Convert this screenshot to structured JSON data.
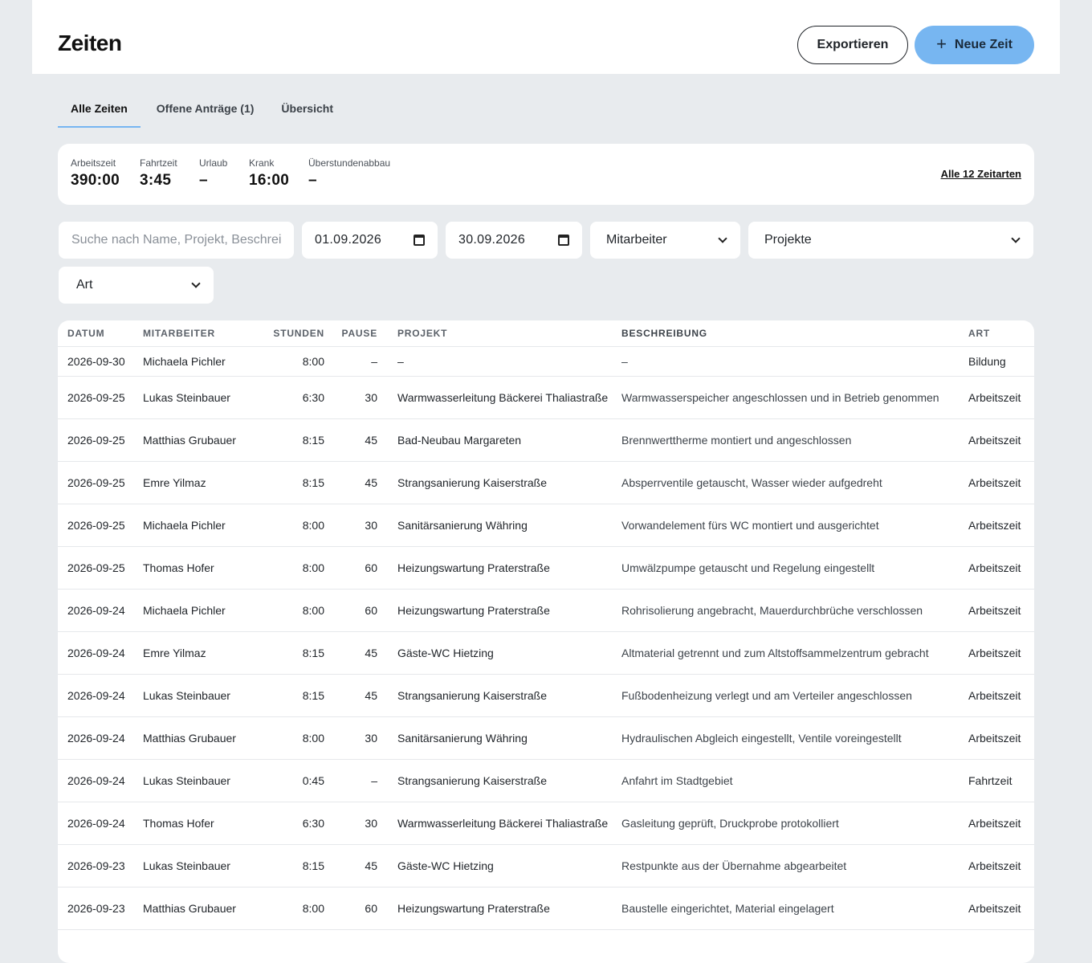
{
  "header": {
    "title": "Zeiten",
    "export_label": "Exportieren",
    "new_label": "Neue Zeit"
  },
  "tabs": [
    {
      "label": "Alle Zeiten",
      "active": true
    },
    {
      "label": "Offene Anträge (1)",
      "active": false
    },
    {
      "label": "Übersicht",
      "active": false
    }
  ],
  "summary": {
    "stats": [
      {
        "label": "Arbeitszeit",
        "value": "390:00"
      },
      {
        "label": "Fahrtzeit",
        "value": "3:45"
      },
      {
        "label": "Urlaub",
        "value": "–"
      },
      {
        "label": "Krank",
        "value": "16:00"
      },
      {
        "label": "Überstundenabbau",
        "value": "–"
      }
    ],
    "all_types_link": "Alle 12 Zeitarten"
  },
  "filters": {
    "search_placeholder": "Suche nach Name, Projekt, Beschreibung",
    "date_from": "01.09.2026",
    "date_to": "30.09.2026",
    "employee": "Mitarbeiter",
    "projects": "Projekte",
    "type": "Art"
  },
  "table": {
    "headers": {
      "date": "DATUM",
      "employee": "MITARBEITER",
      "hours": "STUNDEN",
      "pause": "PAUSE",
      "project": "PROJEKT",
      "description": "BESCHREIBUNG",
      "type": "ART"
    },
    "rows": [
      {
        "date": "2026-09-30",
        "employee": "Michaela Pichler",
        "hours": "8:00",
        "pause": "–",
        "project": "–",
        "description": "–",
        "type": "Bildung"
      },
      {
        "date": "2026-09-25",
        "employee": "Lukas Steinbauer",
        "hours": "6:30",
        "pause": "30",
        "project": "Warmwasserleitung Bäckerei Thaliastraße",
        "description": "Warmwasserspeicher angeschlossen und in Betrieb genommen",
        "type": "Arbeitszeit"
      },
      {
        "date": "2026-09-25",
        "employee": "Matthias Grubauer",
        "hours": "8:15",
        "pause": "45",
        "project": "Bad-Neubau Margareten",
        "description": "Brennwerttherme montiert und angeschlossen",
        "type": "Arbeitszeit"
      },
      {
        "date": "2026-09-25",
        "employee": "Emre Yilmaz",
        "hours": "8:15",
        "pause": "45",
        "project": "Strangsanierung Kaiserstraße",
        "description": "Absperrventile getauscht, Wasser wieder aufgedreht",
        "type": "Arbeitszeit"
      },
      {
        "date": "2026-09-25",
        "employee": "Michaela Pichler",
        "hours": "8:00",
        "pause": "30",
        "project": "Sanitärsanierung Währing",
        "description": "Vorwandelement fürs WC montiert und ausgerichtet",
        "type": "Arbeitszeit"
      },
      {
        "date": "2026-09-25",
        "employee": "Thomas Hofer",
        "hours": "8:00",
        "pause": "60",
        "project": "Heizungswartung Praterstraße",
        "description": "Umwälzpumpe getauscht und Regelung eingestellt",
        "type": "Arbeitszeit"
      },
      {
        "date": "2026-09-24",
        "employee": "Michaela Pichler",
        "hours": "8:00",
        "pause": "60",
        "project": "Heizungswartung Praterstraße",
        "description": "Rohrisolierung angebracht, Mauerdurchbrüche verschlossen",
        "type": "Arbeitszeit"
      },
      {
        "date": "2026-09-24",
        "employee": "Emre Yilmaz",
        "hours": "8:15",
        "pause": "45",
        "project": "Gäste-WC Hietzing",
        "description": "Altmaterial getrennt und zum Altstoffsammelzentrum gebracht",
        "type": "Arbeitszeit"
      },
      {
        "date": "2026-09-24",
        "employee": "Lukas Steinbauer",
        "hours": "8:15",
        "pause": "45",
        "project": "Strangsanierung Kaiserstraße",
        "description": "Fußbodenheizung verlegt und am Verteiler angeschlossen",
        "type": "Arbeitszeit"
      },
      {
        "date": "2026-09-24",
        "employee": "Matthias Grubauer",
        "hours": "8:00",
        "pause": "30",
        "project": "Sanitärsanierung Währing",
        "description": "Hydraulischen Abgleich eingestellt, Ventile voreingestellt",
        "type": "Arbeitszeit"
      },
      {
        "date": "2026-09-24",
        "employee": "Lukas Steinbauer",
        "hours": "0:45",
        "pause": "–",
        "project": "Strangsanierung Kaiserstraße",
        "description": "Anfahrt im Stadtgebiet",
        "type": "Fahrtzeit"
      },
      {
        "date": "2026-09-24",
        "employee": "Thomas Hofer",
        "hours": "6:30",
        "pause": "30",
        "project": "Warmwasserleitung Bäckerei Thaliastraße",
        "description": "Gasleitung geprüft, Druckprobe protokolliert",
        "type": "Arbeitszeit"
      },
      {
        "date": "2026-09-23",
        "employee": "Lukas Steinbauer",
        "hours": "8:15",
        "pause": "45",
        "project": "Gäste-WC Hietzing",
        "description": "Restpunkte aus der Übernahme abgearbeitet",
        "type": "Arbeitszeit"
      },
      {
        "date": "2026-09-23",
        "employee": "Matthias Grubauer",
        "hours": "8:00",
        "pause": "60",
        "project": "Heizungswartung Praterstraße",
        "description": "Baustelle eingerichtet, Material eingelagert",
        "type": "Arbeitszeit"
      }
    ]
  }
}
